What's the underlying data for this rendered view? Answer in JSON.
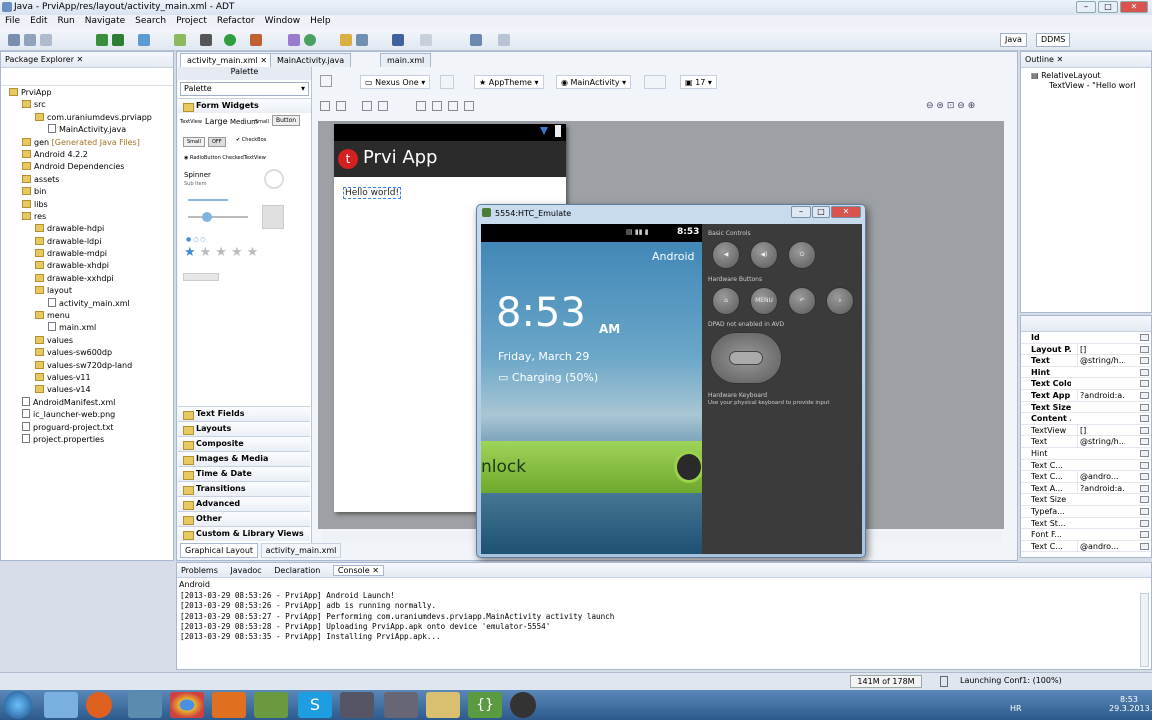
{
  "window": {
    "title": "Java - PrviApp/res/layout/activity_main.xml - ADT"
  },
  "menu": [
    "File",
    "Edit",
    "Run",
    "Navigate",
    "Search",
    "Project",
    "Refactor",
    "Window",
    "Help"
  ],
  "perspectives": [
    "Java",
    "DDMS"
  ],
  "package_explorer": {
    "title": "Package Explorer",
    "items": [
      {
        "label": "PrviApp",
        "indent": 0,
        "kind": "folder"
      },
      {
        "label": "src",
        "indent": 1,
        "kind": "folder"
      },
      {
        "label": "com.uraniumdevs.prviapp",
        "indent": 2,
        "kind": "pkg"
      },
      {
        "label": "MainActivity.java",
        "indent": 3,
        "kind": "file"
      },
      {
        "label": "gen",
        "indent": 1,
        "kind": "folder",
        "suffix": "[Generated Java Files]"
      },
      {
        "label": "Android 4.2.2",
        "indent": 1,
        "kind": "folder"
      },
      {
        "label": "Android Dependencies",
        "indent": 1,
        "kind": "folder"
      },
      {
        "label": "assets",
        "indent": 1,
        "kind": "folder"
      },
      {
        "label": "bin",
        "indent": 1,
        "kind": "folder"
      },
      {
        "label": "libs",
        "indent": 1,
        "kind": "folder"
      },
      {
        "label": "res",
        "indent": 1,
        "kind": "folder"
      },
      {
        "label": "drawable-hdpi",
        "indent": 2,
        "kind": "folder"
      },
      {
        "label": "drawable-ldpi",
        "indent": 2,
        "kind": "folder"
      },
      {
        "label": "drawable-mdpi",
        "indent": 2,
        "kind": "folder"
      },
      {
        "label": "drawable-xhdpi",
        "indent": 2,
        "kind": "folder"
      },
      {
        "label": "drawable-xxhdpi",
        "indent": 2,
        "kind": "folder"
      },
      {
        "label": "layout",
        "indent": 2,
        "kind": "folder"
      },
      {
        "label": "activity_main.xml",
        "indent": 3,
        "kind": "file"
      },
      {
        "label": "menu",
        "indent": 2,
        "kind": "folder"
      },
      {
        "label": "main.xml",
        "indent": 3,
        "kind": "file"
      },
      {
        "label": "values",
        "indent": 2,
        "kind": "folder"
      },
      {
        "label": "values-sw600dp",
        "indent": 2,
        "kind": "folder"
      },
      {
        "label": "values-sw720dp-land",
        "indent": 2,
        "kind": "folder"
      },
      {
        "label": "values-v11",
        "indent": 2,
        "kind": "folder"
      },
      {
        "label": "values-v14",
        "indent": 2,
        "kind": "folder"
      },
      {
        "label": "AndroidManifest.xml",
        "indent": 1,
        "kind": "file"
      },
      {
        "label": "ic_launcher-web.png",
        "indent": 1,
        "kind": "file"
      },
      {
        "label": "proguard-project.txt",
        "indent": 1,
        "kind": "file"
      },
      {
        "label": "project.properties",
        "indent": 1,
        "kind": "file"
      }
    ]
  },
  "editor_tabs": [
    "activity_main.xml",
    "MainActivity.java",
    "main.xml"
  ],
  "palette": {
    "title": "Palette",
    "dropdown": "Palette",
    "section_open": "Form Widgets",
    "widgets": {
      "textview": "TextView",
      "large": "Large",
      "medium": "Medium",
      "small": "Small",
      "button": "Button",
      "small_btn": "Small",
      "off": "OFF",
      "checkbox": "CheckBox",
      "radio": "RadioButton",
      "checked": "CheckedTextView",
      "spinner": "Spinner",
      "sub_item": "Sub Item"
    },
    "sections": [
      "Text Fields",
      "Layouts",
      "Composite",
      "Images & Media",
      "Time & Date",
      "Transitions",
      "Advanced",
      "Other",
      "Custom & Library Views"
    ]
  },
  "layout_toolbar": {
    "device": "Nexus One",
    "theme": "AppTheme",
    "activity": "MainActivity",
    "api": "17"
  },
  "preview": {
    "app_title": "Prvi App",
    "text": "Hello world!"
  },
  "bottom_editor_tabs": [
    "Graphical Layout",
    "activity_main.xml"
  ],
  "emulator": {
    "title": "5554:HTC_Emulate",
    "status_time": "8:53",
    "carrier": "Android",
    "clock": "8:53",
    "ampm": "AM",
    "date": "Friday, March 29",
    "charging": "Charging (50%)",
    "unlock": "nlock",
    "basic_controls": "Basic Controls",
    "hardware_buttons": "Hardware Buttons",
    "menu_label": "MENU",
    "dpad": "DPAD not enabled in AVD",
    "keyboard": "Hardware Keyboard",
    "keyboard_hint": "Use your physical keyboard to provide input"
  },
  "outline": {
    "title": "Outline",
    "items": [
      "RelativeLayout",
      "TextView - \"Hello worl"
    ]
  },
  "properties": [
    {
      "k": "Id",
      "v": "",
      "bold": true
    },
    {
      "k": "Layout P...",
      "v": "[]",
      "bold": true
    },
    {
      "k": "Text",
      "v": "@string/h...",
      "bold": true
    },
    {
      "k": "Hint",
      "v": "",
      "bold": true
    },
    {
      "k": "Text Color",
      "v": "",
      "bold": true
    },
    {
      "k": "Text App...",
      "v": "?android:a...",
      "bold": true
    },
    {
      "k": "Text Size",
      "v": "",
      "bold": true
    },
    {
      "k": "Content ...",
      "v": "",
      "bold": true
    },
    {
      "k": "TextView",
      "v": "[]",
      "bold": false
    },
    {
      "k": "Text",
      "v": "@string/h...",
      "bold": false
    },
    {
      "k": "Hint",
      "v": "",
      "bold": false
    },
    {
      "k": "Text C...",
      "v": "",
      "bold": false
    },
    {
      "k": "Text C...",
      "v": "@andro...",
      "bold": false
    },
    {
      "k": "Text A...",
      "v": "?android:a...",
      "bold": false
    },
    {
      "k": "Text Size",
      "v": "",
      "bold": false
    },
    {
      "k": "Typefa...",
      "v": "",
      "bold": false
    },
    {
      "k": "Text St...",
      "v": "",
      "bold": false
    },
    {
      "k": "Font F...",
      "v": "",
      "bold": false
    },
    {
      "k": "Text C...",
      "v": "@andro...",
      "bold": false
    }
  ],
  "console": {
    "tabs": [
      "Problems",
      "Javadoc",
      "Declaration",
      "Console"
    ],
    "header": "Android",
    "lines": [
      "[2013-03-29 08:53:26 - PrviApp] Android Launch!",
      "[2013-03-29 08:53:26 - PrviApp] adb is running normally.",
      "[2013-03-29 08:53:27 - PrviApp] Performing com.uraniumdevs.prviapp.MainActivity activity launch",
      "[2013-03-29 08:53:28 - PrviApp] Uploading PrviApp.apk onto device 'emulator-5554'",
      "[2013-03-29 08:53:35 - PrviApp] Installing PrviApp.apk..."
    ]
  },
  "status": {
    "memory": "141M of 178M",
    "progress": "Launching Conf1: (100%)"
  },
  "taskbar": {
    "lang": "HR",
    "time": "8:53",
    "date": "29.3.2013."
  },
  "colors": {
    "actionbar": "#2b2b2b",
    "app_icon": "#d32020",
    "lock_green": "#8cc43c",
    "chrome_blue": "#dde6f2"
  }
}
